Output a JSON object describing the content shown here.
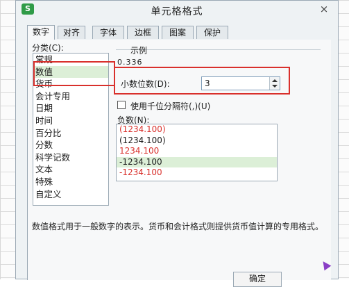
{
  "window": {
    "app_icon": "S",
    "title": "单元格格式",
    "close_icon": "×"
  },
  "tabs": [
    {
      "label": "数字"
    },
    {
      "label": "对齐"
    },
    {
      "label": "字体"
    },
    {
      "label": "边框"
    },
    {
      "label": "图案"
    },
    {
      "label": "保护"
    }
  ],
  "category": {
    "label": "分类(C):",
    "items": [
      "常规",
      "数值",
      "货币",
      "会计专用",
      "日期",
      "时间",
      "百分比",
      "分数",
      "科学记数",
      "文本",
      "特殊",
      "自定义"
    ],
    "selected": "数值"
  },
  "sample": {
    "label": "示例",
    "value": "0.336"
  },
  "decimal": {
    "label": "小数位数(D):",
    "value": "3"
  },
  "thousands": {
    "label": "使用千位分隔符(,)(U)",
    "checked": false
  },
  "negative": {
    "label": "负数(N):",
    "items": [
      {
        "text": "(1234.100)",
        "color": "#d9302c"
      },
      {
        "text": "(1234.100)",
        "color": "#1a1a1a"
      },
      {
        "text": "1234.100",
        "color": "#d9302c"
      },
      {
        "text": "-1234.100",
        "color": "#1a1a1a"
      },
      {
        "text": "-1234.100",
        "color": "#d9302c"
      }
    ],
    "selected_index": 3
  },
  "description": "数值格式用于一般数字的表示。货币和会计格式则提供货币值计算的专用格式。",
  "buttons": {
    "ok": "确定"
  },
  "colors": {
    "highlight_box": "#d9302c",
    "selection": "#dcefd7",
    "app_icon": "#2f9b47"
  }
}
